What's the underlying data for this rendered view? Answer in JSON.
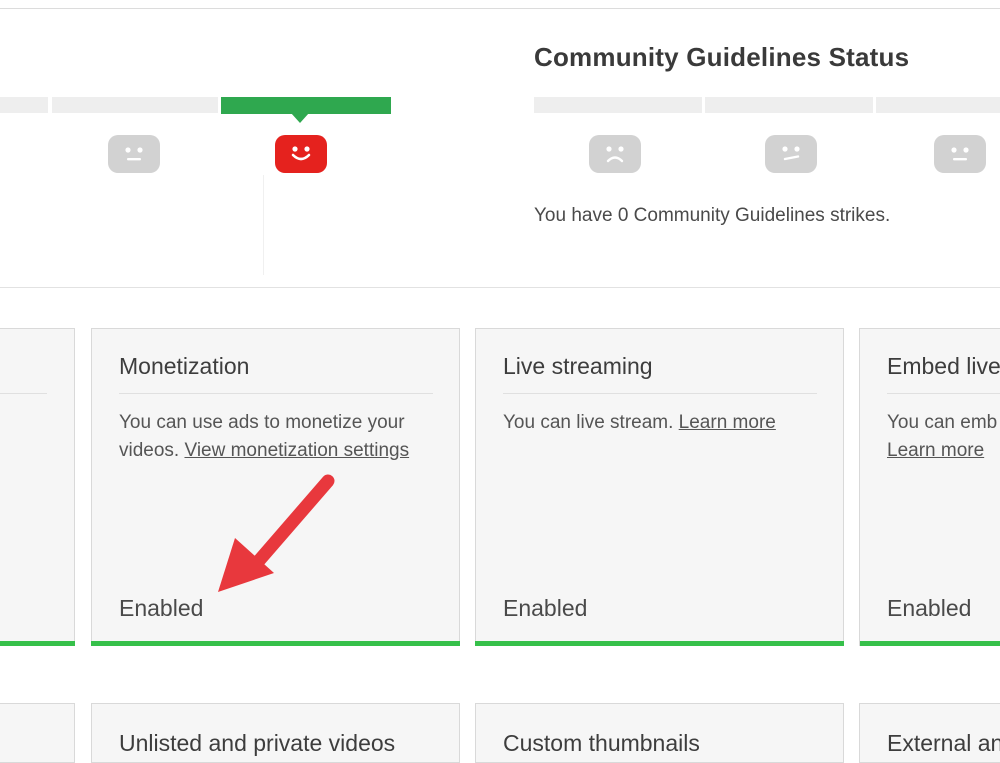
{
  "community": {
    "title": "Community Guidelines Status",
    "strikes_text": "You have 0 Community Guidelines strikes."
  },
  "features": [
    {
      "title": "Monetization",
      "desc_prefix": "You can use ads to monetize your videos. ",
      "link": "View monetization settings",
      "status": "Enabled"
    },
    {
      "title": "Live streaming",
      "desc_prefix": "You can live stream. ",
      "link": "Learn more",
      "status": "Enabled"
    },
    {
      "title": "Embed live",
      "desc_prefix": "You can emb",
      "link": "Learn more",
      "status": "Enabled"
    }
  ],
  "features_row2": [
    {
      "title": "Unlisted and private videos"
    },
    {
      "title": "Custom thumbnails"
    },
    {
      "title": "External an"
    }
  ],
  "colors": {
    "accent_green": "#2fa84f",
    "enabled_green": "#36c04a",
    "status_red": "#e5221e",
    "arrow_red": "#e8383d"
  }
}
